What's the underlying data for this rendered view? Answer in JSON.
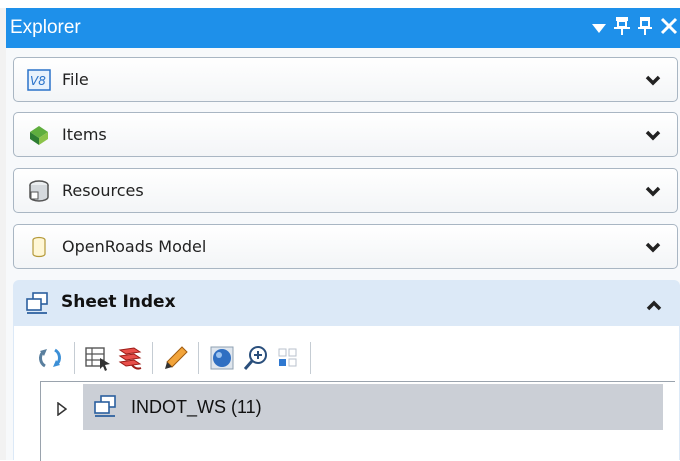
{
  "window": {
    "title": "Explorer",
    "controls": [
      "dropdown-icon",
      "pin-icon",
      "pin-icon",
      "close-icon"
    ]
  },
  "sections": [
    {
      "label": "File",
      "icon": "v8-file-icon",
      "expanded": false
    },
    {
      "label": "Items",
      "icon": "items-icon",
      "expanded": false
    },
    {
      "label": "Resources",
      "icon": "resources-icon",
      "expanded": false
    },
    {
      "label": "OpenRoads Model",
      "icon": "openroads-model-icon",
      "expanded": false
    }
  ],
  "sheet_index": {
    "label": "Sheet Index",
    "icon": "sheet-index-icon",
    "expanded": true,
    "toolbar": [
      "refresh-icon",
      "sheet-properties-icon",
      "stack-icon",
      "edit-icon",
      "globe-icon",
      "zoom-icon",
      "grid-icon"
    ],
    "tree": [
      {
        "label": "INDOT_WS (11)",
        "icon": "sheet-index-icon",
        "expanded": false,
        "selected": true
      }
    ]
  },
  "colors": {
    "titlebar": "#1e90ea",
    "selected_row": "#cbcfd6",
    "section_header_active": "#dce9f7"
  }
}
